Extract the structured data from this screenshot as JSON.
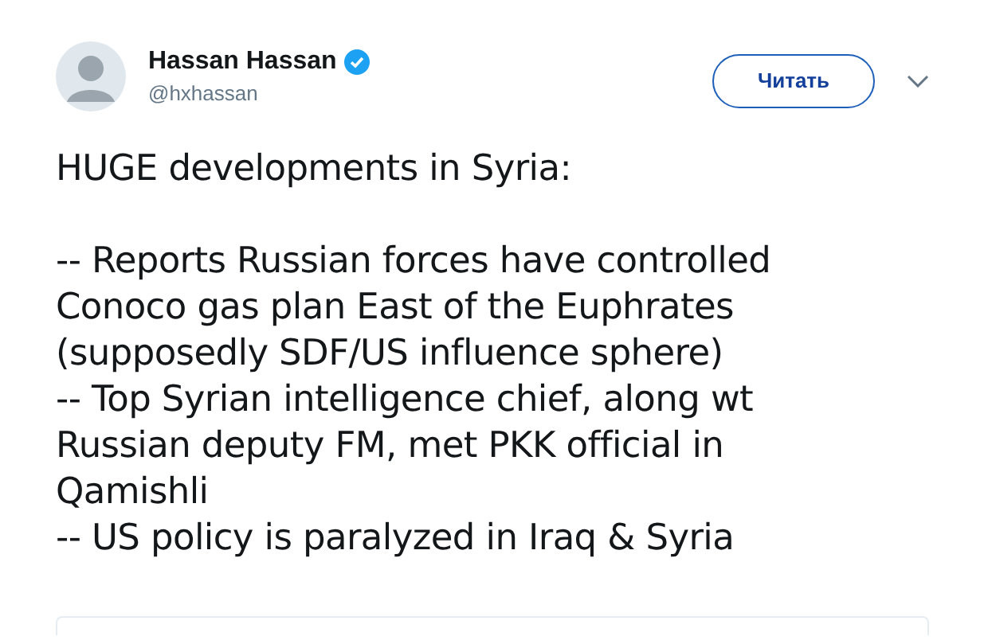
{
  "author": {
    "name": "Hassan Hassan",
    "verified": true,
    "handle": "@hxhassan"
  },
  "follow_button": {
    "label": "Читать"
  },
  "tweet_paragraphs": [
    [
      "HUGE developments in Syria:"
    ],
    [
      "-- Reports Russian forces have controlled",
      "Conoco gas plan East of the Euphrates",
      "(supposedly SDF/US influence sphere)",
      "-- Top Syrian intelligence chief, along wt",
      "Russian deputy FM, met PKK official in",
      "Qamishli",
      "-- US policy is paralyzed in Iraq & Syria"
    ]
  ]
}
